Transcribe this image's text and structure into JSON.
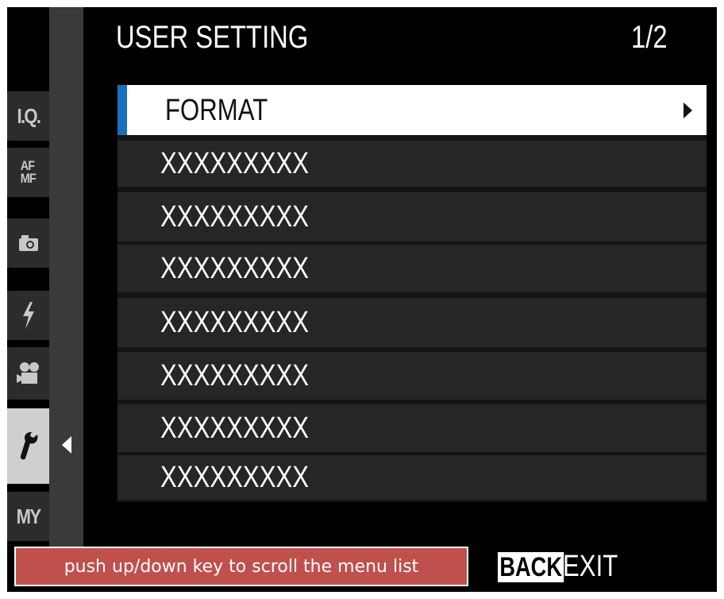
{
  "header": {
    "title": "USER SETTING",
    "page_indicator": "1/2"
  },
  "tabs": [
    {
      "label": "I.Q.",
      "icon": "image-quality-tab",
      "active": false
    },
    {
      "label": "AF\nMF",
      "icon": "focus-tab",
      "active": false
    },
    {
      "label": "",
      "icon": "camera-icon",
      "active": false
    },
    {
      "label": "",
      "icon": "flash-icon",
      "active": false
    },
    {
      "label": "",
      "icon": "movie-camera-icon",
      "active": false
    },
    {
      "label": "",
      "icon": "wrench-icon",
      "active": true
    },
    {
      "label": "MY",
      "icon": "my-menu-tab",
      "active": false
    }
  ],
  "menu": {
    "items": [
      {
        "label": "FORMAT",
        "selected": true,
        "has_submenu": true
      },
      {
        "label": "XXXXXXXXX",
        "selected": false
      },
      {
        "label": "XXXXXXXXX",
        "selected": false
      },
      {
        "label": "XXXXXXXXX",
        "selected": false
      },
      {
        "label": "XXXXXXXXX",
        "selected": false
      },
      {
        "label": "XXXXXXXXX",
        "selected": false
      },
      {
        "label": "XXXXXXXXX",
        "selected": false
      },
      {
        "label": "XXXXXXXXX",
        "selected": false
      }
    ]
  },
  "footer": {
    "hint": "push up/down key to scroll the menu list",
    "back_label": "BACK",
    "exit_label": "EXIT"
  },
  "colors": {
    "selection_accent": "#1b6fbf",
    "hint_background": "#c0504d",
    "screen_background": "#000000"
  }
}
